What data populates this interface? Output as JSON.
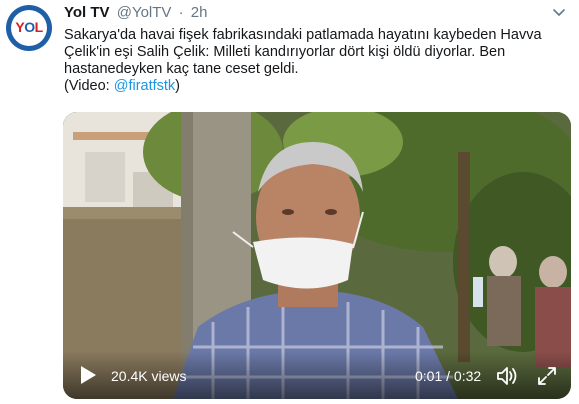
{
  "tweet": {
    "author_name": "Yol TV",
    "author_handle": "@YolTV",
    "separator": "·",
    "time": "2h",
    "text_lines": [
      "Sakarya'da havai fişek fabrikasındaki patlamada hayatını kaybeden Havva",
      "Çelik'in eşi Salih Çelik: Milleti kandırıyorlar dört kişi öldü diyorlar. Ben",
      "hastanedeyken kaç tane ceset geldi."
    ],
    "video_credit_prefix": "(Video: ",
    "video_credit_link": "@firatfstk",
    "video_credit_suffix": ")"
  },
  "avatar": {
    "logo_text_1": "Y",
    "logo_text_2": "O",
    "logo_text_3": "L"
  },
  "video": {
    "views": "20.4K views",
    "time": "0:01 / 0:32",
    "icons": {
      "play": "play-icon",
      "volume": "volume-icon",
      "fullscreen": "fullscreen-icon",
      "more": "chevron-down-icon"
    }
  },
  "colors": {
    "link": "#1b95e0",
    "muted": "#657786",
    "text": "#14171a",
    "brand_blue": "#1f5fa8",
    "brand_red": "#d61f26"
  }
}
